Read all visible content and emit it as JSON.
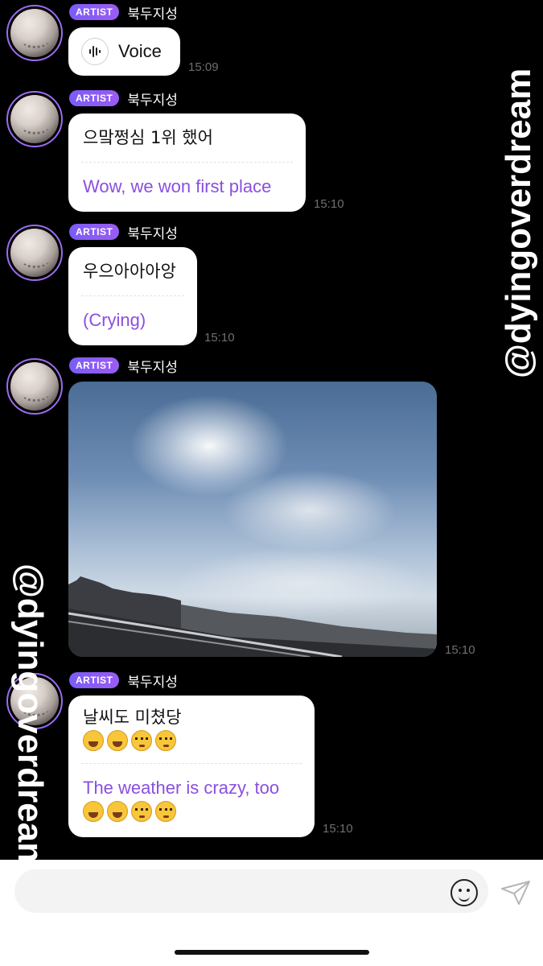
{
  "chat": {
    "messages": [
      {
        "badge": "ARTIST",
        "sender": "북두지성",
        "type": "voice",
        "voice_label": "Voice",
        "time": "15:09"
      },
      {
        "badge": "ARTIST",
        "sender": "북두지성",
        "type": "text",
        "korean": "으맠쩡심 1위 했어",
        "english": "Wow, we won first place",
        "time": "15:10"
      },
      {
        "badge": "ARTIST",
        "sender": "북두지성",
        "type": "text",
        "korean": "우으아아아앙",
        "english": "(Crying)",
        "time": "15:10"
      },
      {
        "badge": "ARTIST",
        "sender": "북두지성",
        "type": "photo",
        "time": "15:10"
      },
      {
        "badge": "ARTIST",
        "sender": "북두지성",
        "type": "text",
        "korean": "날씨도 미쳤당",
        "english": "The weather is crazy, too",
        "emoji": [
          "grinning-squinting",
          "grinning-squinting",
          "pleading",
          "pleading"
        ],
        "time": "15:10"
      }
    ]
  },
  "watermarks": [
    "@dyingoverdream",
    "@dyingoverdream"
  ],
  "footer": {
    "input_placeholder": "",
    "emoji_icon": "smile-icon",
    "send_icon": "send-icon"
  },
  "colors": {
    "accent": "#8a4fe0",
    "badge": "#7b5cf6",
    "background": "#000000"
  }
}
